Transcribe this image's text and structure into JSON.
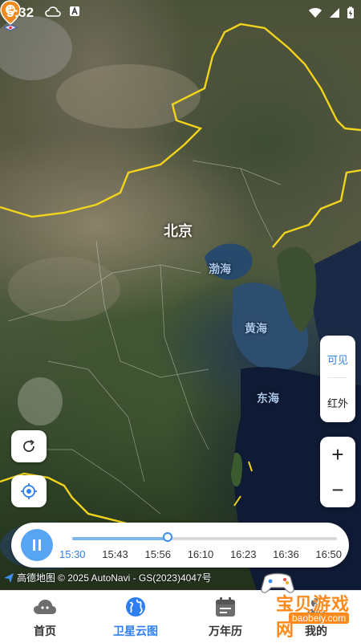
{
  "status_bar": {
    "time": "5:32"
  },
  "map": {
    "capital_label": "北京",
    "sea_labels": {
      "bohai": "渤海",
      "yellow_sea": "黄海",
      "east_china_sea": "东海"
    }
  },
  "layer_panel": {
    "visible": "可见",
    "infrared": "红外",
    "selected": "可见"
  },
  "zoom": {
    "in": "+",
    "out": "−"
  },
  "timeline": {
    "playing": true,
    "current_time": "15:30",
    "progress": 0.36,
    "ticks": [
      "15:30",
      "15:43",
      "15:56",
      "16:10",
      "16:23",
      "16:36",
      "16:50"
    ]
  },
  "attribution": {
    "logo_text": "高德地图",
    "text": "© 2025 AutoNavi - GS(2023)4047号"
  },
  "bottom_nav": {
    "items": [
      {
        "label": "首页",
        "icon": "cloud-icon"
      },
      {
        "label": "卫星云图",
        "icon": "globe-icon"
      },
      {
        "label": "万年历",
        "icon": "calendar-icon"
      },
      {
        "label": "我的",
        "icon": "profile-icon"
      }
    ],
    "active": "卫星云图"
  },
  "watermark": {
    "text": "宝贝游戏网",
    "url": "baobeiy.com"
  },
  "colors": {
    "accent": "#2f7ff0",
    "border_line": "#f2d41c",
    "pin": "#f08a1c"
  }
}
